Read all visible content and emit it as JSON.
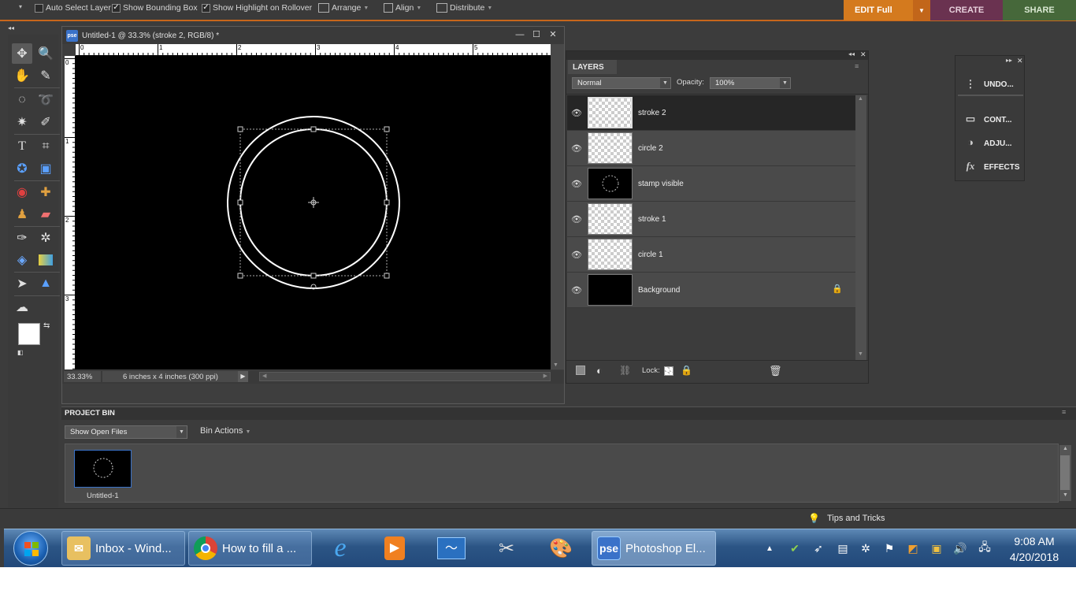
{
  "options_bar": {
    "auto_select_layer": "Auto Select Layer",
    "show_bounding_box": "Show Bounding Box",
    "show_highlight": "Show Highlight on Rollover",
    "arrange": "Arrange",
    "align": "Align",
    "distribute": "Distribute",
    "checkbox_checked": "✓"
  },
  "mode_tabs": {
    "edit": "EDIT Full",
    "create": "CREATE",
    "share": "SHARE"
  },
  "document": {
    "badge": "pse",
    "title": "Untitled-1 @ 33.3% (stroke 2, RGB/8) *",
    "zoom": "33.33%",
    "size_info": "6 inches x 4 inches (300 ppi)",
    "ruler_top": [
      "0",
      "1",
      "2",
      "3",
      "4",
      "5"
    ],
    "ruler_left": [
      "0",
      "1",
      "2",
      "3"
    ]
  },
  "layers_panel": {
    "title": "LAYERS",
    "blend_mode": "Normal",
    "opacity_label": "Opacity:",
    "opacity_value": "100%",
    "lock_label": "Lock:",
    "layers": [
      {
        "name": "stroke 2",
        "thumb": "checker",
        "active": true
      },
      {
        "name": "circle 2",
        "thumb": "checker",
        "active": false
      },
      {
        "name": "stamp visible",
        "thumb": "black-circle",
        "active": false
      },
      {
        "name": "stroke 1",
        "thumb": "checker",
        "active": false
      },
      {
        "name": "circle 1",
        "thumb": "checker",
        "active": false
      },
      {
        "name": "Background",
        "thumb": "black",
        "active": false,
        "locked": true
      }
    ]
  },
  "mini_panel": {
    "undo": "UNDO...",
    "content": "CONT...",
    "adjust": "ADJU...",
    "effects": "EFFECTS"
  },
  "project_bin": {
    "title": "PROJECT BIN",
    "show_dropdown": "Show Open Files",
    "bin_actions": "Bin Actions",
    "file_label": "Untitled-1"
  },
  "tips": {
    "label": "Tips and Tricks"
  },
  "taskbar": {
    "tasks": [
      {
        "label": "Inbox - Wind...",
        "icon": "mail-icon"
      },
      {
        "label": "How to fill a ...",
        "icon": "chrome-icon"
      },
      {
        "label": "Photoshop El...",
        "icon": "pse-icon",
        "badge": "pse"
      }
    ],
    "time": "9:08 AM",
    "date": "4/20/2018"
  }
}
